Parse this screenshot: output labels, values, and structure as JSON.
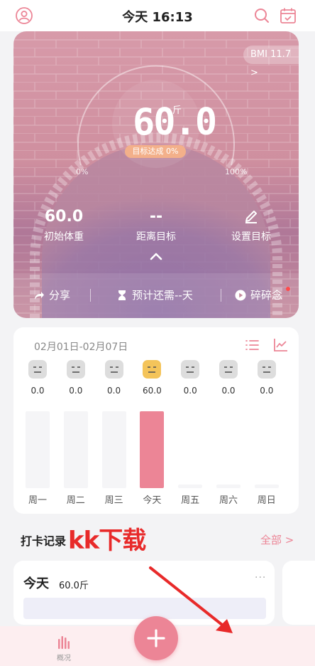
{
  "header": {
    "title": "今天 16:13"
  },
  "hero": {
    "bmi": "BMI 11.7 >",
    "current_weight": "60.0",
    "unit": "斤",
    "goal_progress": "目标达成 0%",
    "pct_left": "0%",
    "pct_right": "100%",
    "stats": [
      {
        "value": "60.0",
        "label": "初始体重"
      },
      {
        "value": "--",
        "label": "距离目标"
      },
      {
        "value": "",
        "label": "设置目标"
      }
    ],
    "actions": {
      "share": "分享",
      "estimate": "预计还需--天",
      "notes": "碎碎念"
    }
  },
  "week": {
    "range": "02月01日-02月07日",
    "days": [
      {
        "name": "周一",
        "value": "0.0",
        "level": 0.9
      },
      {
        "name": "周二",
        "value": "0.0",
        "level": 0.9
      },
      {
        "name": "周三",
        "value": "0.0",
        "level": 0.9
      },
      {
        "name": "今天",
        "value": "60.0",
        "level": 0.9,
        "today": true
      },
      {
        "name": "周五",
        "value": "0.0",
        "level": 0.04
      },
      {
        "name": "周六",
        "value": "0.0",
        "level": 0.04
      },
      {
        "name": "周日",
        "value": "0.0",
        "level": 0.04
      }
    ]
  },
  "records": {
    "title": "打卡记录",
    "watermark": "kk下载",
    "all_link": "全部 >",
    "card": {
      "day": "今天",
      "weight": "60.0斤",
      "more": "···"
    }
  },
  "nav": {
    "overview": "概况"
  },
  "colors": {
    "accent": "#ec8596",
    "today_face": "#f4c45a",
    "goal_pill": "#f3b08a"
  }
}
